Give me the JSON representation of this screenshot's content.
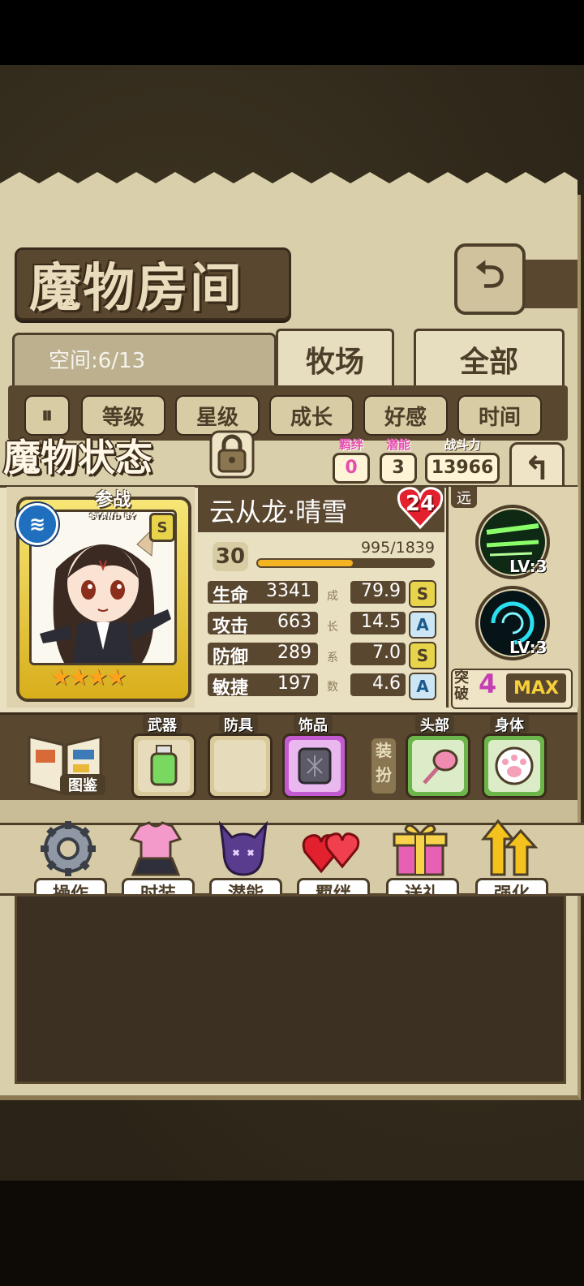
{
  "header": {
    "title": "魔物房间",
    "back_icon": "back-arrow-icon"
  },
  "storage": {
    "space_label": "空间:6/13",
    "tabs": [
      {
        "label": "牧场"
      },
      {
        "label": "全部"
      }
    ]
  },
  "sort": {
    "buttons": [
      "等级",
      "星级",
      "成长",
      "好感",
      "时间"
    ]
  },
  "status": {
    "title": "魔物状态",
    "bond": {
      "label": "羁绊",
      "value": "0"
    },
    "potential": {
      "label": "潜能",
      "value": "3"
    },
    "power": {
      "label": "战斗力",
      "value": "13966"
    }
  },
  "monster": {
    "standby": "参战",
    "standby_sub": "STAND BY",
    "rank": "S",
    "stars": "★★★★",
    "name": "云从龙·晴雪",
    "affinity": "24",
    "level": "30",
    "exp": "995/1839",
    "exp_fraction": 0.541,
    "stats": [
      {
        "label": "生命",
        "value": "3341",
        "growth": "79.9",
        "grade": "S"
      },
      {
        "label": "攻击",
        "value": "663",
        "growth": "14.5",
        "grade": "A"
      },
      {
        "label": "防御",
        "value": "289",
        "growth": "7.0",
        "grade": "S"
      },
      {
        "label": "敏捷",
        "value": "197",
        "growth": "4.6",
        "grade": "A"
      }
    ],
    "growth_label_chars": [
      "成",
      "长",
      "系",
      "数"
    ],
    "range": "远",
    "skills": [
      {
        "level": "LV:3"
      },
      {
        "level": "LV:3"
      }
    ],
    "breakthrough_label": "突破",
    "breakthrough": "4",
    "max": "MAX"
  },
  "equipment": {
    "book_label": "图鉴",
    "slots": [
      {
        "label": "武器"
      },
      {
        "label": "防具"
      },
      {
        "label": "饰品"
      }
    ],
    "dress_label": "装扮",
    "dress_slots": [
      {
        "label": "头部"
      },
      {
        "label": "身体"
      }
    ]
  },
  "menu": {
    "items": [
      {
        "label": "操作",
        "icon": "gear-icon"
      },
      {
        "label": "时装",
        "icon": "outfit-icon"
      },
      {
        "label": "潜能",
        "icon": "demon-icon"
      },
      {
        "label": "羁绊",
        "icon": "hearts-icon"
      },
      {
        "label": "送礼",
        "icon": "gift-icon"
      },
      {
        "label": "强化",
        "icon": "upgrade-arrows-icon"
      }
    ]
  },
  "colors": {
    "panel": "#d9cfaa",
    "frame": "#4d3e29",
    "accent_pink": "#e64db0",
    "gold": "#f4b422"
  }
}
